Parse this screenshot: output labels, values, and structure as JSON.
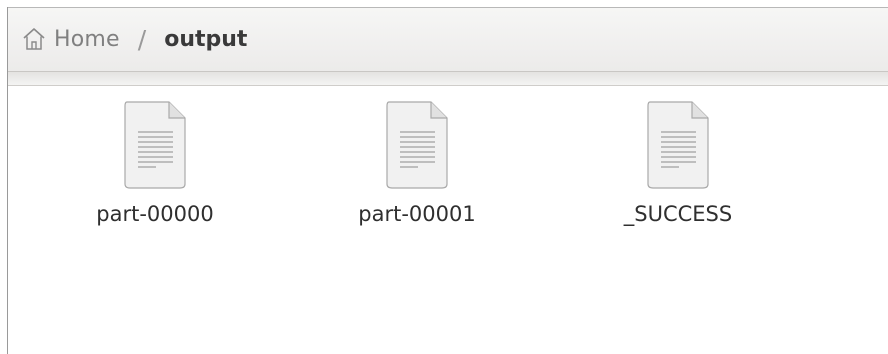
{
  "breadcrumb": {
    "home_label": "Home",
    "separator": "/",
    "current_label": "output"
  },
  "files": [
    {
      "name": "part-00000",
      "icon": "text-file-icon"
    },
    {
      "name": "part-00001",
      "icon": "text-file-icon"
    },
    {
      "name": "_SUCCESS",
      "icon": "text-file-icon"
    }
  ],
  "icons": {
    "home": "home-icon"
  },
  "colors": {
    "toolbar_background": "#efeeed",
    "text_primary": "#2f2f2f",
    "text_muted": "#808080"
  }
}
